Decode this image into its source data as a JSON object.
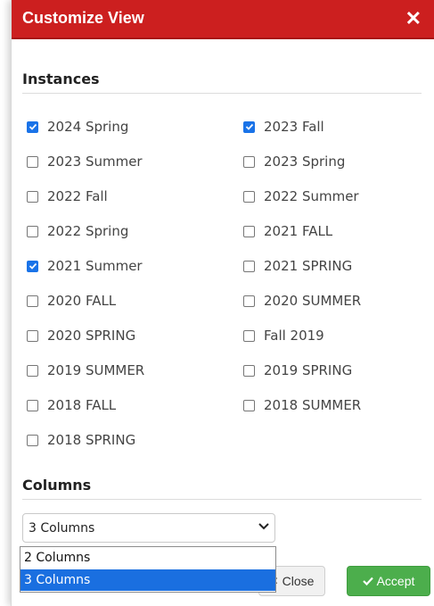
{
  "dialog": {
    "title": "Customize View",
    "close_symbol": "✕"
  },
  "instances": {
    "heading": "Instances",
    "items": [
      {
        "label": "2024 Spring",
        "checked": true
      },
      {
        "label": "2023 Fall",
        "checked": true
      },
      {
        "label": "2023 Summer",
        "checked": false
      },
      {
        "label": "2023 Spring",
        "checked": false
      },
      {
        "label": "2022 Fall",
        "checked": false
      },
      {
        "label": "2022 Summer",
        "checked": false
      },
      {
        "label": "2022 Spring",
        "checked": false
      },
      {
        "label": "2021 FALL",
        "checked": false
      },
      {
        "label": "2021 Summer",
        "checked": true
      },
      {
        "label": "2021 SPRING",
        "checked": false
      },
      {
        "label": "2020 FALL",
        "checked": false
      },
      {
        "label": "2020 SUMMER",
        "checked": false
      },
      {
        "label": "2020 SPRING",
        "checked": false
      },
      {
        "label": "Fall 2019",
        "checked": false
      },
      {
        "label": "2019 SUMMER",
        "checked": false
      },
      {
        "label": "2019 SPRING",
        "checked": false
      },
      {
        "label": "2018 FALL",
        "checked": false
      },
      {
        "label": "2018 SUMMER",
        "checked": false
      },
      {
        "label": "2018 SPRING",
        "checked": false
      }
    ]
  },
  "columns": {
    "heading": "Columns",
    "selected": "3 Columns",
    "options": [
      "2 Columns",
      "3 Columns"
    ]
  },
  "buttons": {
    "close_label": "Close",
    "accept_label": "Accept"
  },
  "colors": {
    "titlebar": "#cc1f1f",
    "checkbox_checked": "#1a73e8",
    "accept": "#4cae4c",
    "option_selected": "#1a6fe0"
  }
}
